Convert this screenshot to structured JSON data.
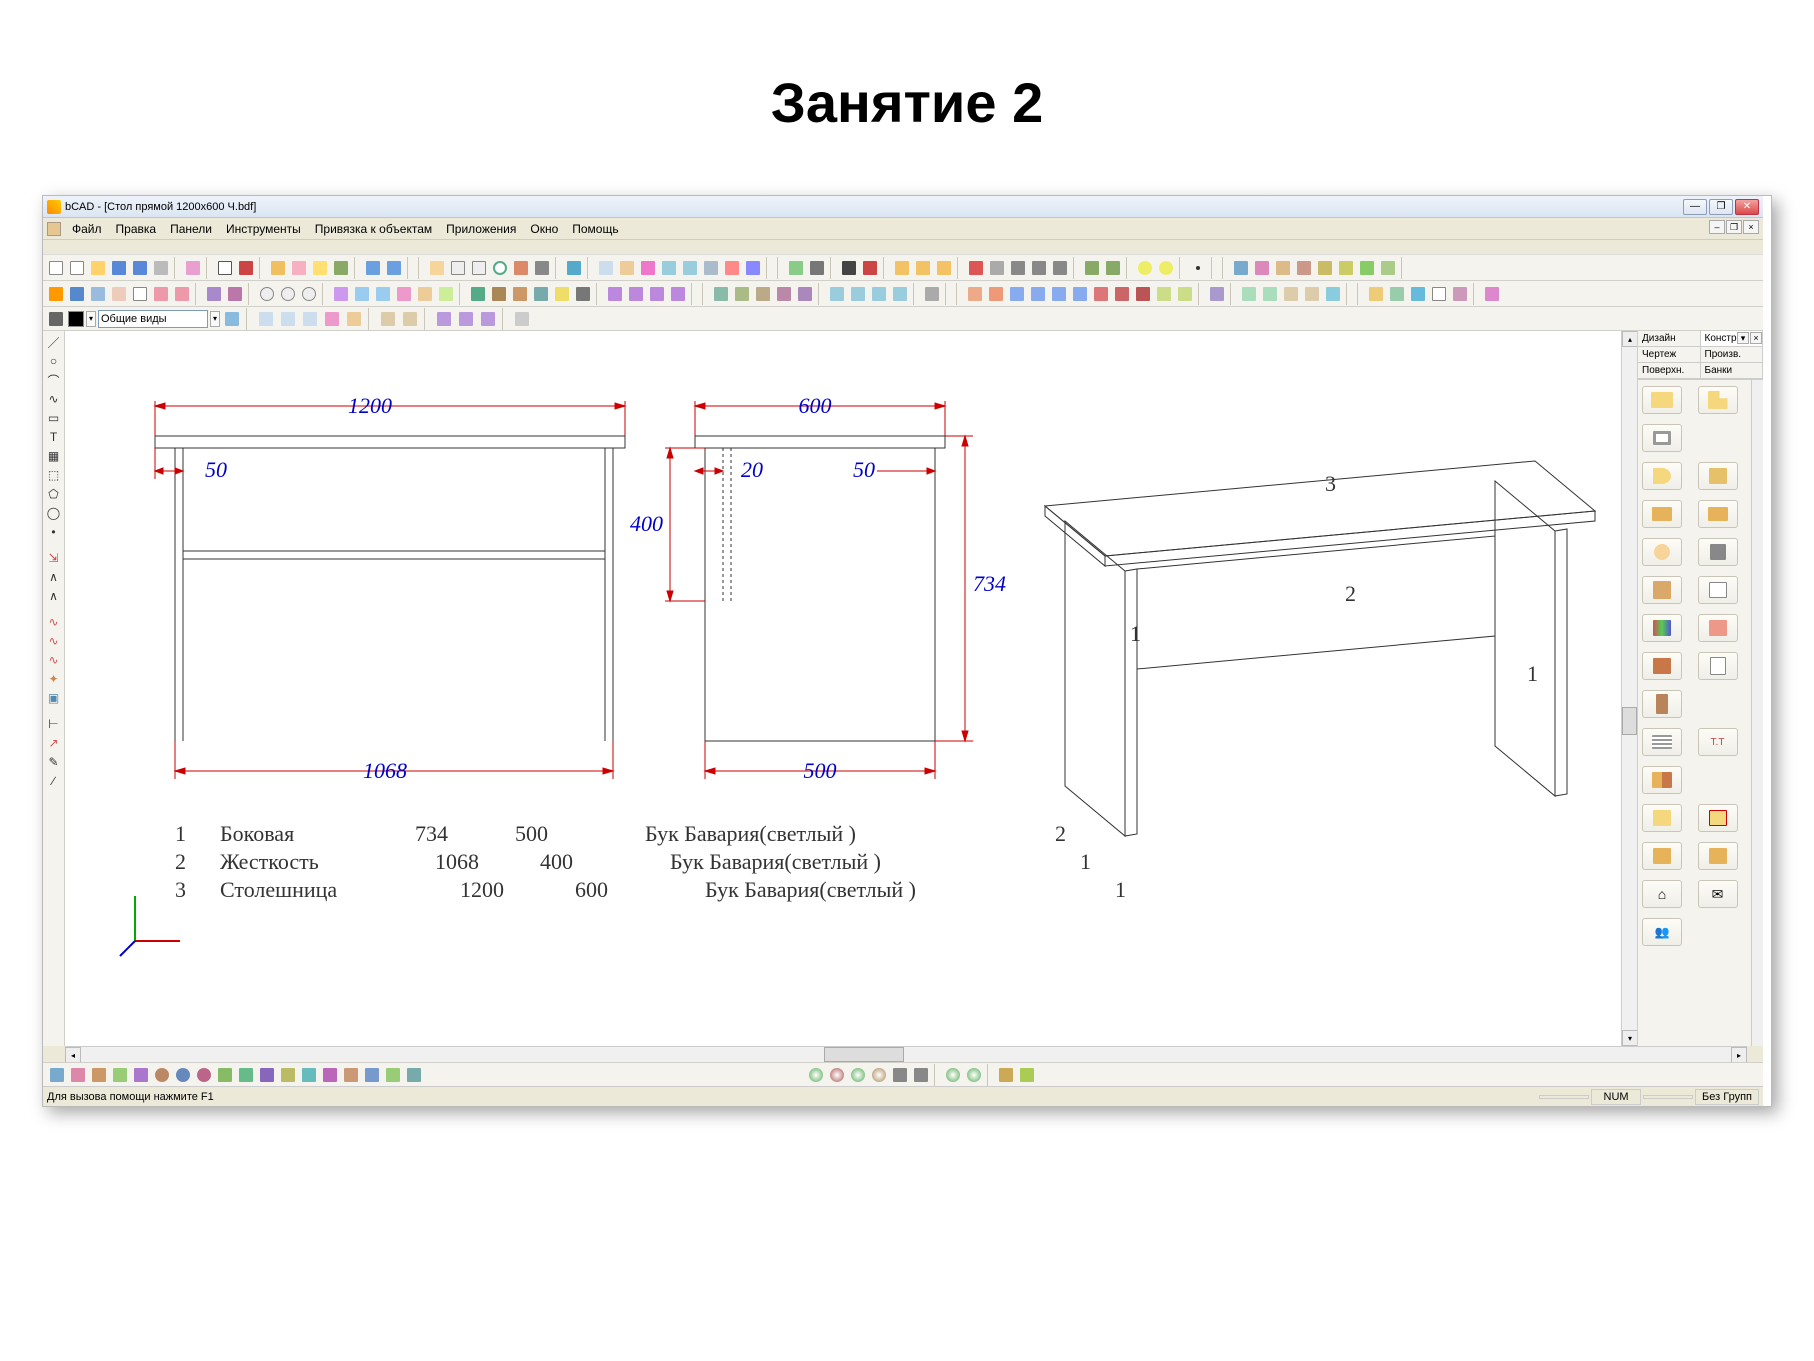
{
  "slide_title": "Занятие 2",
  "window": {
    "title": "bCAD - [Стол прямой 1200x600 Ч.bdf]",
    "buttons": {
      "min": "—",
      "max": "❐",
      "close": "✕"
    }
  },
  "menu": {
    "items": [
      "Файл",
      "Правка",
      "Панели",
      "Инструменты",
      "Привязка к объектам",
      "Приложения",
      "Окно",
      "Помощь"
    ]
  },
  "view_dropdown": "Общие виды",
  "right_panel": {
    "tabs": [
      "Дизайн",
      "Констр.",
      "Чертеж",
      "Произв.",
      "Поверхн.",
      "Банки"
    ],
    "active_tab_index": 1
  },
  "statusbar": {
    "hint": "Для вызова помощи нажмите F1",
    "num": "NUM",
    "group": "Без Групп"
  },
  "drawing": {
    "dims": {
      "front_width": "1200",
      "front_inset": "50",
      "front_inner": "1068",
      "side_width": "600",
      "side_inset_left": "20",
      "side_inset_right": "50",
      "side_inner": "500",
      "apron_h": "400",
      "total_h": "734"
    },
    "labels_3d": {
      "p1": "1",
      "p2": "2",
      "p3": "3",
      "p1b": "1"
    },
    "parts": [
      {
        "n": "1",
        "name": "Боковая",
        "dim_a": "734",
        "dim_b": "500",
        "material": "Бук Бавария(светлый )",
        "qty": "2"
      },
      {
        "n": "2",
        "name": "Жесткость",
        "dim_a": "1068",
        "dim_b": "400",
        "material": "Бук Бавария(светлый )",
        "qty": "1"
      },
      {
        "n": "3",
        "name": "Столешница",
        "dim_a": "1200",
        "dim_b": "600",
        "material": "Бук Бавария(светлый )",
        "qty": "1"
      }
    ]
  }
}
